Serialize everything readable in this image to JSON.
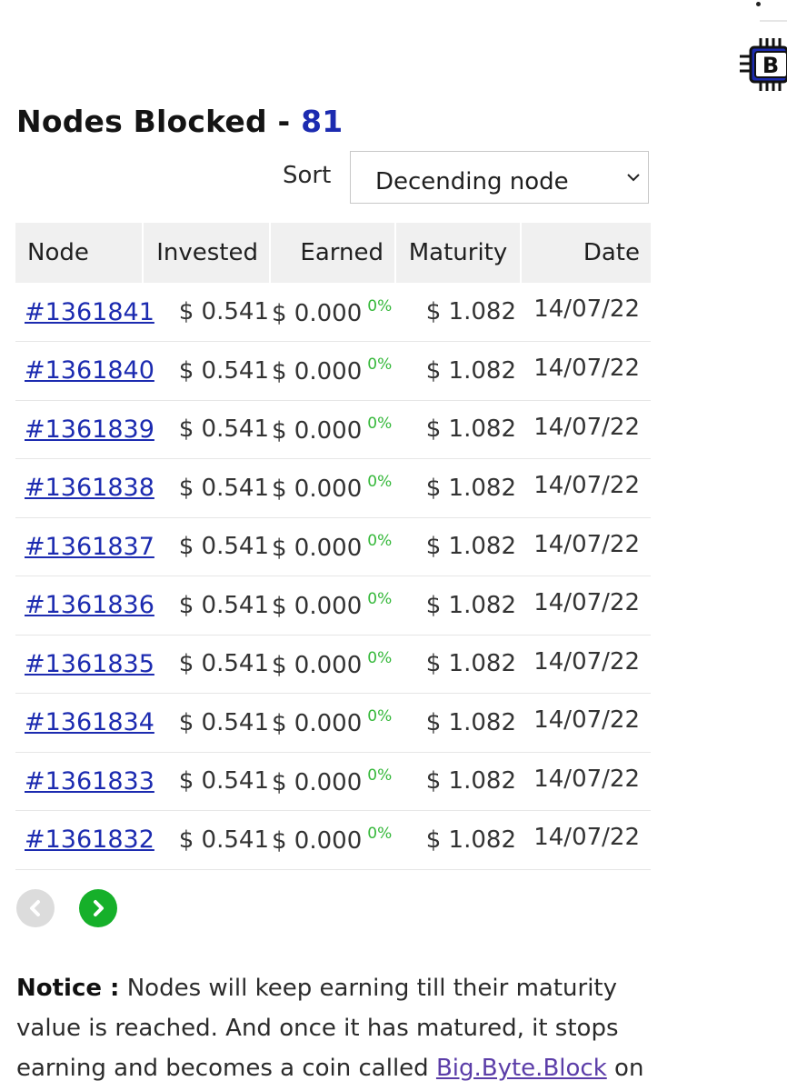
{
  "header": {
    "title": "Nodes Blocked -",
    "count": "81"
  },
  "sort": {
    "label": "Sort",
    "selected": "Decending node"
  },
  "table": {
    "columns": [
      "Node",
      "Invested",
      "Earned",
      "Maturity",
      "Date"
    ],
    "rows": [
      {
        "node": "#1361841",
        "invested": "$ 0.541",
        "earned": "$ 0.000",
        "pct": "0%",
        "maturity": "$ 1.082",
        "date": "14/07/22"
      },
      {
        "node": "#1361840",
        "invested": "$ 0.541",
        "earned": "$ 0.000",
        "pct": "0%",
        "maturity": "$ 1.082",
        "date": "14/07/22"
      },
      {
        "node": "#1361839",
        "invested": "$ 0.541",
        "earned": "$ 0.000",
        "pct": "0%",
        "maturity": "$ 1.082",
        "date": "14/07/22"
      },
      {
        "node": "#1361838",
        "invested": "$ 0.541",
        "earned": "$ 0.000",
        "pct": "0%",
        "maturity": "$ 1.082",
        "date": "14/07/22"
      },
      {
        "node": "#1361837",
        "invested": "$ 0.541",
        "earned": "$ 0.000",
        "pct": "0%",
        "maturity": "$ 1.082",
        "date": "14/07/22"
      },
      {
        "node": "#1361836",
        "invested": "$ 0.541",
        "earned": "$ 0.000",
        "pct": "0%",
        "maturity": "$ 1.082",
        "date": "14/07/22"
      },
      {
        "node": "#1361835",
        "invested": "$ 0.541",
        "earned": "$ 0.000",
        "pct": "0%",
        "maturity": "$ 1.082",
        "date": "14/07/22"
      },
      {
        "node": "#1361834",
        "invested": "$ 0.541",
        "earned": "$ 0.000",
        "pct": "0%",
        "maturity": "$ 1.082",
        "date": "14/07/22"
      },
      {
        "node": "#1361833",
        "invested": "$ 0.541",
        "earned": "$ 0.000",
        "pct": "0%",
        "maturity": "$ 1.082",
        "date": "14/07/22"
      },
      {
        "node": "#1361832",
        "invested": "$ 0.541",
        "earned": "$ 0.000",
        "pct": "0%",
        "maturity": "$ 1.082",
        "date": "14/07/22"
      }
    ]
  },
  "pager": {
    "prev_icon": "chevron-left-icon",
    "next_icon": "chevron-right-icon",
    "prev_color": "#dcdcdc",
    "next_color": "#16b02a"
  },
  "notice": {
    "label": "Notice :",
    "text": " Nodes will keep earning till their maturity value is reached. And once it has matured, it stops earning and becomes a coin called ",
    "link": "Big.Byte.Block",
    "tail": " on"
  },
  "logo": {
    "icon": "bitcoin-chip-icon",
    "letter": "B",
    "accent": "#1c2bb0"
  },
  "colors": {
    "link": "#1c2bb0",
    "percent": "#35b83a",
    "header_bg": "#f0f0f0"
  }
}
